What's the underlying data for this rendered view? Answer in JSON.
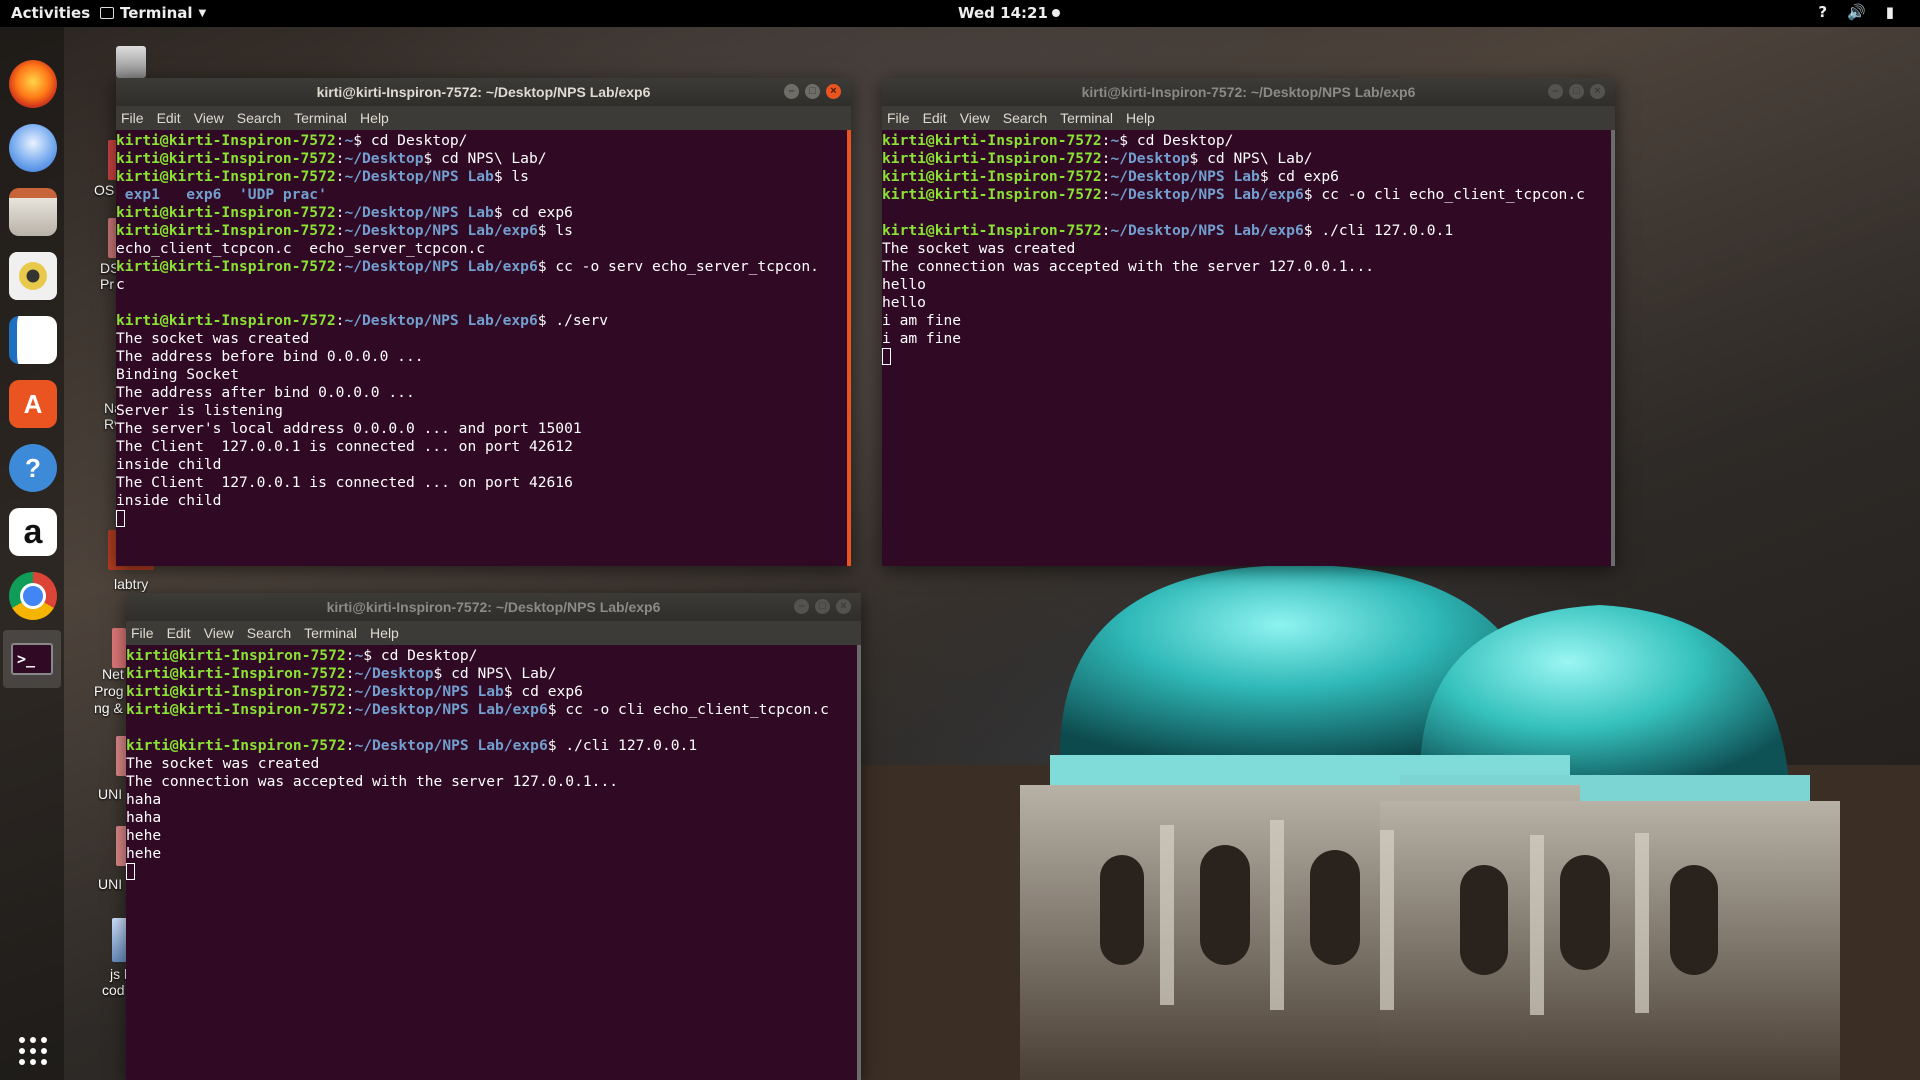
{
  "topbar": {
    "activities": "Activities",
    "app_menu": "Terminal",
    "clock": "Wed 14:21",
    "tray_help": "?",
    "tray_volume": "🔊",
    "tray_battery": "▮"
  },
  "dock": {
    "items": [
      {
        "name": "firefox-icon",
        "color": "#ff6611"
      },
      {
        "name": "thunderbird-icon",
        "color": "#2a6fd6"
      },
      {
        "name": "files-icon",
        "color": "#c7643a"
      },
      {
        "name": "rhythmbox-icon",
        "color": "#e8c94a"
      },
      {
        "name": "writer-icon",
        "color": "#1e6fbf"
      },
      {
        "name": "software-center-icon",
        "color": "#e95420"
      },
      {
        "name": "help-icon",
        "color": "#3c8ad8"
      },
      {
        "name": "amazon-icon",
        "color": "#ffffff"
      },
      {
        "name": "chrome-icon",
        "color": "#4285f4"
      },
      {
        "name": "terminal-icon",
        "color": "#300a24"
      }
    ],
    "amazon_glyph": "a",
    "help_glyph": "?",
    "terminal_glyph": ">_"
  },
  "desktop": {
    "labels": {
      "os": "OS",
      "ds": "DS",
      "pr": "Pr",
      "na": "Na",
      "rv": "Rv",
      "labtry": "labtry",
      "net": "Net",
      "prog": "Prog",
      "ng": "ng &",
      "uni1": "UNI",
      "uni2": "UNI",
      "js": "js l",
      "cod": "cod"
    }
  },
  "terminals": {
    "server": {
      "title": "kirti@kirti-Inspiron-7572: ~/Desktop/NPS Lab/exp6",
      "menu": [
        "File",
        "Edit",
        "View",
        "Search",
        "Terminal",
        "Help"
      ],
      "lines": [
        {
          "user": "kirti@kirti-Inspiron-7572",
          "path": "~",
          "cmd": "$ cd Desktop/"
        },
        {
          "user": "kirti@kirti-Inspiron-7572",
          "path": "~/Desktop",
          "cmd": "$ cd NPS\\ Lab/"
        },
        {
          "user": "kirti@kirti-Inspiron-7572",
          "path": "~/Desktop/NPS Lab",
          "cmd": "$ ls"
        },
        {
          "dirs": " exp1   exp6  'UDP prac'"
        },
        {
          "user": "kirti@kirti-Inspiron-7572",
          "path": "~/Desktop/NPS Lab",
          "cmd": "$ cd exp6"
        },
        {
          "user": "kirti@kirti-Inspiron-7572",
          "path": "~/Desktop/NPS Lab/exp6",
          "cmd": "$ ls"
        },
        {
          "text": "echo_client_tcpcon.c  echo_server_tcpcon.c"
        },
        {
          "user": "kirti@kirti-Inspiron-7572",
          "path": "~/Desktop/NPS Lab/exp6",
          "cmd": "$ cc -o serv echo_server_tcpcon."
        },
        {
          "text": "c"
        },
        {
          "text": ""
        },
        {
          "user": "kirti@kirti-Inspiron-7572",
          "path": "~/Desktop/NPS Lab/exp6",
          "cmd": "$ ./serv"
        },
        {
          "text": "The socket was created"
        },
        {
          "text": "The address before bind 0.0.0.0 ..."
        },
        {
          "text": "Binding Socket"
        },
        {
          "text": "The address after bind 0.0.0.0 ..."
        },
        {
          "text": "Server is listening"
        },
        {
          "text": "The server's local address 0.0.0.0 ... and port 15001"
        },
        {
          "text": "The Client  127.0.0.1 is connected ... on port 42612"
        },
        {
          "text": "inside child"
        },
        {
          "text": "The Client  127.0.0.1 is connected ... on port 42616"
        },
        {
          "text": "inside child"
        },
        {
          "cursor": true
        }
      ]
    },
    "client1": {
      "title": "kirti@kirti-Inspiron-7572: ~/Desktop/NPS Lab/exp6",
      "menu": [
        "File",
        "Edit",
        "View",
        "Search",
        "Terminal",
        "Help"
      ],
      "lines": [
        {
          "user": "kirti@kirti-Inspiron-7572",
          "path": "~",
          "cmd": "$ cd Desktop/"
        },
        {
          "user": "kirti@kirti-Inspiron-7572",
          "path": "~/Desktop",
          "cmd": "$ cd NPS\\ Lab/"
        },
        {
          "user": "kirti@kirti-Inspiron-7572",
          "path": "~/Desktop/NPS Lab",
          "cmd": "$ cd exp6"
        },
        {
          "user": "kirti@kirti-Inspiron-7572",
          "path": "~/Desktop/NPS Lab/exp6",
          "cmd": "$ cc -o cli echo_client_tcpcon.c"
        },
        {
          "text": ""
        },
        {
          "user": "kirti@kirti-Inspiron-7572",
          "path": "~/Desktop/NPS Lab/exp6",
          "cmd": "$ ./cli 127.0.0.1"
        },
        {
          "text": "The socket was created"
        },
        {
          "text": "The connection was accepted with the server 127.0.0.1..."
        },
        {
          "text": "hello"
        },
        {
          "text": "hello"
        },
        {
          "text": "i am fine"
        },
        {
          "text": "i am fine"
        },
        {
          "cursor": true
        }
      ]
    },
    "client2": {
      "title": "kirti@kirti-Inspiron-7572: ~/Desktop/NPS Lab/exp6",
      "menu": [
        "File",
        "Edit",
        "View",
        "Search",
        "Terminal",
        "Help"
      ],
      "lines": [
        {
          "user": "kirti@kirti-Inspiron-7572",
          "path": "~",
          "cmd": "$ cd Desktop/"
        },
        {
          "user": "kirti@kirti-Inspiron-7572",
          "path": "~/Desktop",
          "cmd": "$ cd NPS\\ Lab/"
        },
        {
          "user": "kirti@kirti-Inspiron-7572",
          "path": "~/Desktop/NPS Lab",
          "cmd": "$ cd exp6"
        },
        {
          "user": "kirti@kirti-Inspiron-7572",
          "path": "~/Desktop/NPS Lab/exp6",
          "cmd": "$ cc -o cli echo_client_tcpcon.c"
        },
        {
          "text": ""
        },
        {
          "user": "kirti@kirti-Inspiron-7572",
          "path": "~/Desktop/NPS Lab/exp6",
          "cmd": "$ ./cli 127.0.0.1"
        },
        {
          "text": "The socket was created"
        },
        {
          "text": "The connection was accepted with the server 127.0.0.1..."
        },
        {
          "text": "haha"
        },
        {
          "text": "haha"
        },
        {
          "text": "hehe"
        },
        {
          "text": "hehe"
        },
        {
          "cursor": true
        }
      ]
    }
  },
  "colors": {
    "terminal_bg": "#300a24",
    "prompt_user": "#8ae234",
    "prompt_path": "#729fcf",
    "accent": "#e95420"
  }
}
